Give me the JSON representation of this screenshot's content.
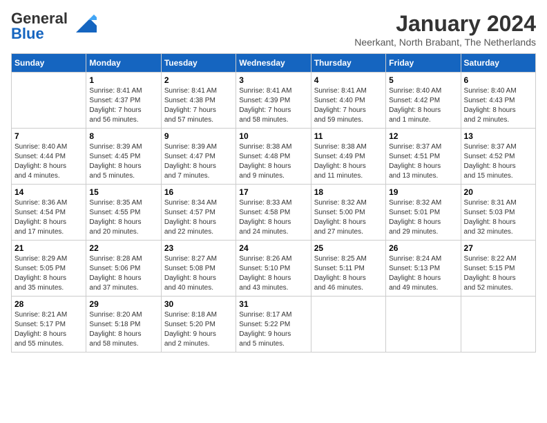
{
  "header": {
    "logo_general": "General",
    "logo_blue": "Blue",
    "month_year": "January 2024",
    "location": "Neerkant, North Brabant, The Netherlands"
  },
  "columns": [
    "Sunday",
    "Monday",
    "Tuesday",
    "Wednesday",
    "Thursday",
    "Friday",
    "Saturday"
  ],
  "weeks": [
    [
      {
        "day": "",
        "info": ""
      },
      {
        "day": "1",
        "info": "Sunrise: 8:41 AM\nSunset: 4:37 PM\nDaylight: 7 hours\nand 56 minutes."
      },
      {
        "day": "2",
        "info": "Sunrise: 8:41 AM\nSunset: 4:38 PM\nDaylight: 7 hours\nand 57 minutes."
      },
      {
        "day": "3",
        "info": "Sunrise: 8:41 AM\nSunset: 4:39 PM\nDaylight: 7 hours\nand 58 minutes."
      },
      {
        "day": "4",
        "info": "Sunrise: 8:41 AM\nSunset: 4:40 PM\nDaylight: 7 hours\nand 59 minutes."
      },
      {
        "day": "5",
        "info": "Sunrise: 8:40 AM\nSunset: 4:42 PM\nDaylight: 8 hours\nand 1 minute."
      },
      {
        "day": "6",
        "info": "Sunrise: 8:40 AM\nSunset: 4:43 PM\nDaylight: 8 hours\nand 2 minutes."
      }
    ],
    [
      {
        "day": "7",
        "info": "Sunrise: 8:40 AM\nSunset: 4:44 PM\nDaylight: 8 hours\nand 4 minutes."
      },
      {
        "day": "8",
        "info": "Sunrise: 8:39 AM\nSunset: 4:45 PM\nDaylight: 8 hours\nand 5 minutes."
      },
      {
        "day": "9",
        "info": "Sunrise: 8:39 AM\nSunset: 4:47 PM\nDaylight: 8 hours\nand 7 minutes."
      },
      {
        "day": "10",
        "info": "Sunrise: 8:38 AM\nSunset: 4:48 PM\nDaylight: 8 hours\nand 9 minutes."
      },
      {
        "day": "11",
        "info": "Sunrise: 8:38 AM\nSunset: 4:49 PM\nDaylight: 8 hours\nand 11 minutes."
      },
      {
        "day": "12",
        "info": "Sunrise: 8:37 AM\nSunset: 4:51 PM\nDaylight: 8 hours\nand 13 minutes."
      },
      {
        "day": "13",
        "info": "Sunrise: 8:37 AM\nSunset: 4:52 PM\nDaylight: 8 hours\nand 15 minutes."
      }
    ],
    [
      {
        "day": "14",
        "info": "Sunrise: 8:36 AM\nSunset: 4:54 PM\nDaylight: 8 hours\nand 17 minutes."
      },
      {
        "day": "15",
        "info": "Sunrise: 8:35 AM\nSunset: 4:55 PM\nDaylight: 8 hours\nand 20 minutes."
      },
      {
        "day": "16",
        "info": "Sunrise: 8:34 AM\nSunset: 4:57 PM\nDaylight: 8 hours\nand 22 minutes."
      },
      {
        "day": "17",
        "info": "Sunrise: 8:33 AM\nSunset: 4:58 PM\nDaylight: 8 hours\nand 24 minutes."
      },
      {
        "day": "18",
        "info": "Sunrise: 8:32 AM\nSunset: 5:00 PM\nDaylight: 8 hours\nand 27 minutes."
      },
      {
        "day": "19",
        "info": "Sunrise: 8:32 AM\nSunset: 5:01 PM\nDaylight: 8 hours\nand 29 minutes."
      },
      {
        "day": "20",
        "info": "Sunrise: 8:31 AM\nSunset: 5:03 PM\nDaylight: 8 hours\nand 32 minutes."
      }
    ],
    [
      {
        "day": "21",
        "info": "Sunrise: 8:29 AM\nSunset: 5:05 PM\nDaylight: 8 hours\nand 35 minutes."
      },
      {
        "day": "22",
        "info": "Sunrise: 8:28 AM\nSunset: 5:06 PM\nDaylight: 8 hours\nand 37 minutes."
      },
      {
        "day": "23",
        "info": "Sunrise: 8:27 AM\nSunset: 5:08 PM\nDaylight: 8 hours\nand 40 minutes."
      },
      {
        "day": "24",
        "info": "Sunrise: 8:26 AM\nSunset: 5:10 PM\nDaylight: 8 hours\nand 43 minutes."
      },
      {
        "day": "25",
        "info": "Sunrise: 8:25 AM\nSunset: 5:11 PM\nDaylight: 8 hours\nand 46 minutes."
      },
      {
        "day": "26",
        "info": "Sunrise: 8:24 AM\nSunset: 5:13 PM\nDaylight: 8 hours\nand 49 minutes."
      },
      {
        "day": "27",
        "info": "Sunrise: 8:22 AM\nSunset: 5:15 PM\nDaylight: 8 hours\nand 52 minutes."
      }
    ],
    [
      {
        "day": "28",
        "info": "Sunrise: 8:21 AM\nSunset: 5:17 PM\nDaylight: 8 hours\nand 55 minutes."
      },
      {
        "day": "29",
        "info": "Sunrise: 8:20 AM\nSunset: 5:18 PM\nDaylight: 8 hours\nand 58 minutes."
      },
      {
        "day": "30",
        "info": "Sunrise: 8:18 AM\nSunset: 5:20 PM\nDaylight: 9 hours\nand 2 minutes."
      },
      {
        "day": "31",
        "info": "Sunrise: 8:17 AM\nSunset: 5:22 PM\nDaylight: 9 hours\nand 5 minutes."
      },
      {
        "day": "",
        "info": ""
      },
      {
        "day": "",
        "info": ""
      },
      {
        "day": "",
        "info": ""
      }
    ]
  ]
}
